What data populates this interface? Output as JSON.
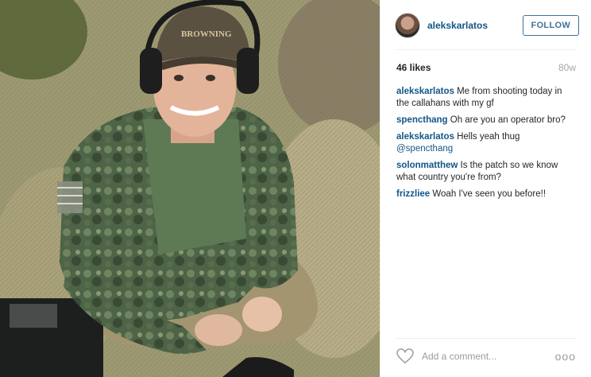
{
  "post": {
    "username": "alekskarlatos",
    "follow_label": "FOLLOW",
    "likes": "46 likes",
    "age": "80w",
    "cap_text": "BROWNING",
    "comments": [
      {
        "user": "alekskarlatos",
        "text": "Me from shooting today in the callahans with my gf"
      },
      {
        "user": "spencthang",
        "text": "Oh are you an operator bro?"
      },
      {
        "user": "alekskarlatos",
        "text": "Hells yeah thug",
        "mention": "@spencthang"
      },
      {
        "user": "solonmatthew",
        "text": "Is the patch so we know what country you're from?"
      },
      {
        "user": "frizzliee",
        "text": "Woah I've seen you before!!"
      }
    ],
    "add_comment_placeholder": "Add a comment...",
    "more_label": "ooo"
  },
  "icons": {
    "like": "heart-icon",
    "options": "more-options-icon"
  },
  "colors": {
    "link": "#125688",
    "follow_border": "#3f729b",
    "muted": "#a5a7aa"
  }
}
